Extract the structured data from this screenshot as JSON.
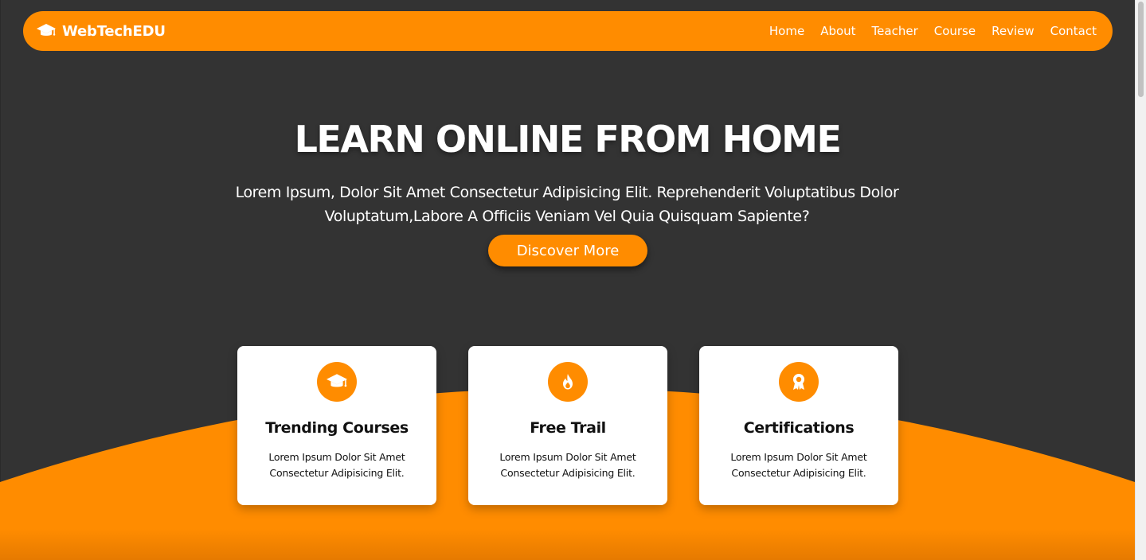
{
  "theme": {
    "accent": "#ff8c00",
    "background": "#333333",
    "card": "#ffffff"
  },
  "navbar": {
    "brand": {
      "icon": "graduation-cap-icon",
      "name": "WebTechEDU"
    },
    "links": [
      "Home",
      "About",
      "Teacher",
      "Course",
      "Review",
      "Contact"
    ]
  },
  "hero": {
    "title": "LEARN ONLINE FROM HOME",
    "text": "Lorem Ipsum, Dolor Sit Amet Consectetur Adipisicing Elit. Reprehenderit Voluptatibus Dolor Voluptatum,Labore A Officiis Veniam Vel Quia Quisquam Sapiente?",
    "button_label": "Discover More"
  },
  "features": [
    {
      "icon": "graduation-cap-icon",
      "title": "Trending Courses",
      "text": "Lorem Ipsum Dolor Sit Amet Consectetur Adipisicing Elit."
    },
    {
      "icon": "fire-icon",
      "title": "Free Trail",
      "text": "Lorem Ipsum Dolor Sit Amet Consectetur Adipisicing Elit."
    },
    {
      "icon": "award-icon",
      "title": "Certifications",
      "text": "Lorem Ipsum Dolor Sit Amet Consectetur Adipisicing Elit."
    }
  ]
}
